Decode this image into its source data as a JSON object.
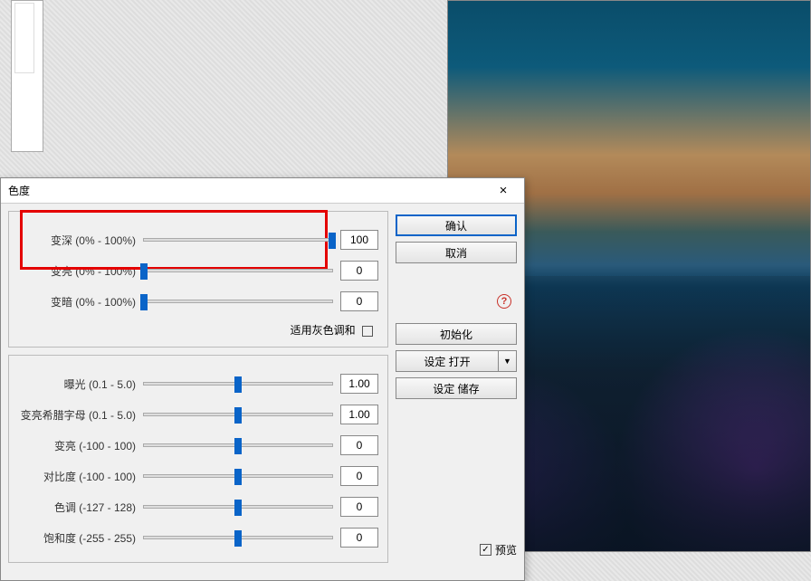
{
  "dialog": {
    "title": "色度",
    "close": "×"
  },
  "sliders_top": [
    {
      "label": "变深 (0% - 100%)",
      "value": "100",
      "pos": 100
    },
    {
      "label": "变亮 (0% - 100%)",
      "value": "0",
      "pos": 0
    },
    {
      "label": "变暗 (0% - 100%)",
      "value": "0",
      "pos": 0
    }
  ],
  "grayscale_label": "适用灰色调和",
  "sliders_bottom": [
    {
      "label": "曝光 (0.1 - 5.0)",
      "value": "1.00",
      "pos": 50
    },
    {
      "label": "变亮希腊字母 (0.1 - 5.0)",
      "value": "1.00",
      "pos": 50
    },
    {
      "label": "变亮 (-100 - 100)",
      "value": "0",
      "pos": 50
    },
    {
      "label": "对比度 (-100 - 100)",
      "value": "0",
      "pos": 50
    },
    {
      "label": "色调 (-127 - 128)",
      "value": "0",
      "pos": 50
    },
    {
      "label": "饱和度 (-255 - 255)",
      "value": "0",
      "pos": 50
    }
  ],
  "buttons": {
    "ok": "确认",
    "cancel": "取消",
    "reset": "初始化",
    "open_preset": "设定 打开",
    "save_preset": "设定 储存",
    "dropdown_arrow": "▼"
  },
  "preview_label": "预览",
  "help_icon": "?"
}
